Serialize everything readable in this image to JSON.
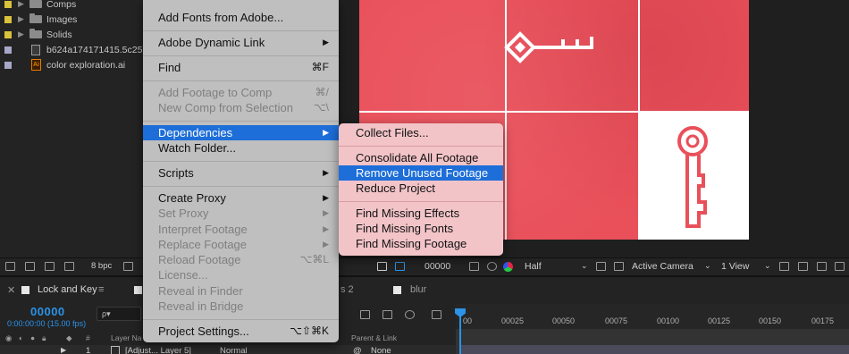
{
  "project_panel": {
    "items": [
      {
        "name": "Comps",
        "type": "folder",
        "chip": "#d9c23c"
      },
      {
        "name": "Images",
        "type": "folder",
        "chip": "#d9c23c"
      },
      {
        "name": "Solids",
        "type": "folder",
        "chip": "#d9c23c"
      },
      {
        "name": "b624a174171415.5c251",
        "type": "file",
        "chip": "#a7a7c8"
      },
      {
        "name": "color exploration.ai",
        "type": "ai",
        "chip": "#a7a7c8"
      }
    ],
    "ai_icon_text": "Ai"
  },
  "main_menu": {
    "items": [
      {
        "label": "Add Fonts from Adobe...",
        "shortcut": "",
        "submenu": false,
        "disabled": false
      },
      {
        "label": "Adobe Dynamic Link",
        "shortcut": "",
        "submenu": true,
        "disabled": false
      },
      {
        "label": "Find",
        "shortcut": "⌘F",
        "submenu": false,
        "disabled": false
      },
      {
        "label": "Add Footage to Comp",
        "shortcut": "⌘/",
        "submenu": false,
        "disabled": true
      },
      {
        "label": "New Comp from Selection",
        "shortcut": "⌥\\",
        "submenu": false,
        "disabled": true
      },
      {
        "label": "Dependencies",
        "shortcut": "",
        "submenu": true,
        "disabled": false,
        "active": true
      },
      {
        "label": "Watch Folder...",
        "shortcut": "",
        "submenu": false,
        "disabled": false
      },
      {
        "label": "Scripts",
        "shortcut": "",
        "submenu": true,
        "disabled": false
      },
      {
        "label": "Create Proxy",
        "shortcut": "",
        "submenu": true,
        "disabled": false
      },
      {
        "label": "Set Proxy",
        "shortcut": "",
        "submenu": true,
        "disabled": true
      },
      {
        "label": "Interpret Footage",
        "shortcut": "",
        "submenu": true,
        "disabled": true
      },
      {
        "label": "Replace Footage",
        "shortcut": "",
        "submenu": true,
        "disabled": true
      },
      {
        "label": "Reload Footage",
        "shortcut": "⌥⌘L",
        "submenu": false,
        "disabled": true
      },
      {
        "label": "License...",
        "shortcut": "",
        "submenu": false,
        "disabled": true
      },
      {
        "label": "Reveal in Finder",
        "shortcut": "",
        "submenu": false,
        "disabled": true
      },
      {
        "label": "Reveal in Bridge",
        "shortcut": "",
        "submenu": false,
        "disabled": true
      },
      {
        "label": "Project Settings...",
        "shortcut": "⌥⇧⌘K",
        "submenu": false,
        "disabled": false
      }
    ],
    "submenu_arrow": "▶"
  },
  "dependencies_menu": {
    "items": [
      {
        "label": "Collect Files...",
        "active": false
      },
      {
        "label": "Consolidate All Footage",
        "active": false
      },
      {
        "label": "Remove Unused Footage",
        "active": true
      },
      {
        "label": "Reduce Project",
        "active": false
      },
      {
        "label": "Find Missing Effects",
        "active": false
      },
      {
        "label": "Find Missing Fonts",
        "active": false
      },
      {
        "label": "Find Missing Footage",
        "active": false
      }
    ]
  },
  "viewer_toolbar": {
    "bpc": "8 bpc",
    "timecode": "00000",
    "resolution": "Half",
    "camera": "Active Camera",
    "views": "1 View"
  },
  "timeline": {
    "tabs": [
      {
        "label": "Lock and Key",
        "menu": "≡"
      },
      {
        "label": "s 2"
      },
      {
        "label": "blur"
      }
    ],
    "current_time": "00000",
    "fps": "0:00:00:00 (15.00 fps)",
    "search_placeholder": "ρ▾",
    "columns": {
      "index": "#",
      "layer_name": "Layer Na",
      "parent_link": "Parent & Link"
    },
    "layer": {
      "index": "1",
      "name": "[Adjust... Layer 5]",
      "mode": "Normal",
      "parent": "None"
    },
    "ruler_ticks": [
      "00",
      "00025",
      "00050",
      "00075",
      "00100",
      "00125",
      "00150",
      "00175"
    ]
  },
  "colors": {
    "accent_blue": "#1d6ed8",
    "timecode_blue": "#2b93e8",
    "comp_red": "#e9505a",
    "menu_bg": "#bfbfbf",
    "submenu_bg": "#f2c4c8"
  }
}
